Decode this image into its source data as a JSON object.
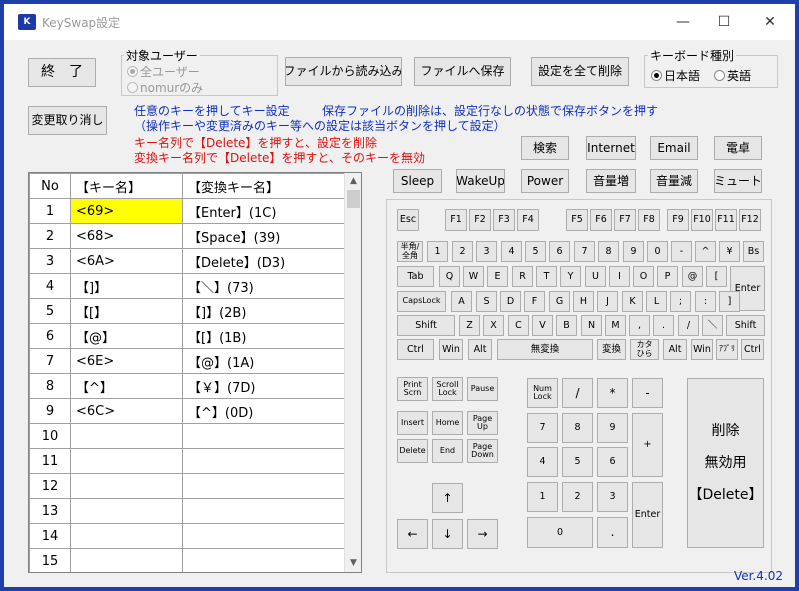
{
  "window": {
    "title": "KeySwap設定",
    "minimize": "—",
    "maximize": "☐",
    "close": "✕",
    "version": "Ver.4.02"
  },
  "toolbar": {
    "exit": "終　了",
    "load": "ファイルから読み込み",
    "save": "ファイルへ保存",
    "delete_all": "設定を全て削除",
    "undo": "変更取り消し"
  },
  "user_group": {
    "label": "対象ユーザー",
    "all_users": "全ユーザー",
    "current_user": "nomurのみ"
  },
  "kb_type": {
    "label": "キーボード種別",
    "japanese": "日本語",
    "english": "英語"
  },
  "instructions": {
    "line1": "任意のキーを押してキー設定",
    "line1b": "保存ファイルの削除は、設定行なしの状態で保存ボタンを押す",
    "line2": "（操作キーや変更済みのキー等への設定は該当ボタンを押して設定）",
    "red1": "キー名列で【Delete】を押すと、設定を削除",
    "red2": "変換キー名列で【Delete】を押すと、そのキーを無効"
  },
  "special_keys": {
    "search": "検索",
    "internet": "Internet",
    "email": "Email",
    "calculator": "電卓",
    "sleep": "Sleep",
    "wakeup": "WakeUp",
    "power": "Power",
    "vol_up": "音量増",
    "vol_down": "音量減",
    "mute": "ミュート"
  },
  "table": {
    "headers": [
      "No",
      "【キー名】",
      "【変換キー名】"
    ],
    "rows": [
      {
        "no": "1",
        "key": "<69>",
        "mapped": "【Enter】(1C)"
      },
      {
        "no": "2",
        "key": "<68>",
        "mapped": "【Space】(39)"
      },
      {
        "no": "3",
        "key": "<6A>",
        "mapped": "【Delete】(D3)"
      },
      {
        "no": "4",
        "key": "【]】",
        "mapped": "【＼】(73)"
      },
      {
        "no": "5",
        "key": "【[】",
        "mapped": "【]】(2B)"
      },
      {
        "no": "6",
        "key": "【@】",
        "mapped": "【[】(1B)"
      },
      {
        "no": "7",
        "key": "<6E>",
        "mapped": "【@】(1A)"
      },
      {
        "no": "8",
        "key": "【^】",
        "mapped": "【￥】(7D)"
      },
      {
        "no": "9",
        "key": "<6C>",
        "mapped": "【^】(0D)"
      },
      {
        "no": "10",
        "key": "",
        "mapped": ""
      },
      {
        "no": "11",
        "key": "",
        "mapped": ""
      },
      {
        "no": "12",
        "key": "",
        "mapped": ""
      },
      {
        "no": "13",
        "key": "",
        "mapped": ""
      },
      {
        "no": "14",
        "key": "",
        "mapped": ""
      },
      {
        "no": "15",
        "key": "",
        "mapped": ""
      }
    ]
  },
  "keyboard": {
    "esc": "Esc",
    "f": [
      "F1",
      "F2",
      "F3",
      "F4",
      "F5",
      "F6",
      "F7",
      "F8",
      "F9",
      "F10",
      "F11",
      "F12"
    ],
    "hankaku": "半角/\n全角",
    "num_row": [
      "1",
      "2",
      "3",
      "4",
      "5",
      "6",
      "7",
      "8",
      "9",
      "0",
      "-",
      "^",
      "¥"
    ],
    "bs": "Bs",
    "tab": "Tab",
    "q_row": [
      "Q",
      "W",
      "E",
      "R",
      "T",
      "Y",
      "U",
      "I",
      "O",
      "P",
      "@",
      "["
    ],
    "enter": "Enter",
    "capslock": "CapsLock",
    "a_row": [
      "A",
      "S",
      "D",
      "F",
      "G",
      "H",
      "J",
      "K",
      "L",
      ";",
      ":",
      "]"
    ],
    "shift": "Shift",
    "z_row": [
      "Z",
      "X",
      "C",
      "V",
      "B",
      "N",
      "M",
      ",",
      ".",
      "/",
      "＼"
    ],
    "ctrl": "Ctrl",
    "win": "Win",
    "alt": "Alt",
    "muhenkan": "無変換",
    "henkan": "変換",
    "kana": "カタ\nひら",
    "app": "ｱﾌﾟﾘ",
    "printscrn": "Print\nScrn",
    "scrolllock": "Scroll\nLock",
    "pause": "Pause",
    "insert": "Insert",
    "home": "Home",
    "pageup": "Page\nUp",
    "delete": "Delete",
    "end": "End",
    "pagedown": "Page\nDown",
    "up": "↑",
    "left": "←",
    "down": "↓",
    "right": "→",
    "numlock": "Num\nLock",
    "np_div": "/",
    "np_mul": "*",
    "np_sub": "-",
    "np_add": "+",
    "np": [
      "0",
      "1",
      "2",
      "3",
      "4",
      "5",
      "6",
      "7",
      "8",
      "9"
    ],
    "np_dot": ".",
    "np_enter": "Enter",
    "big_delete": "削除\n無効用\n【Delete】"
  }
}
